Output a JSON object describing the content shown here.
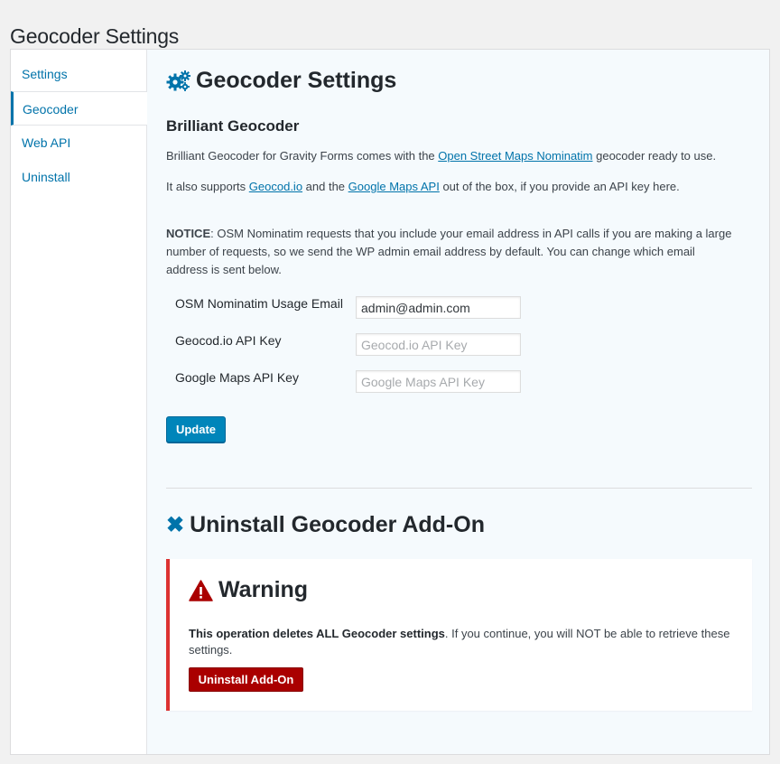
{
  "page_title": "Geocoder Settings",
  "sidebar": {
    "items": [
      {
        "label": "Settings",
        "active": false
      },
      {
        "label": "Geocoder",
        "active": true
      },
      {
        "label": "Web API",
        "active": false
      },
      {
        "label": "Uninstall",
        "active": false
      }
    ]
  },
  "main": {
    "heading": "Geocoder Settings",
    "heading_icon": "gears-icon",
    "subheading": "Brilliant Geocoder",
    "intro": {
      "before": "Brilliant Geocoder for Gravity Forms comes with the ",
      "link": "Open Street Maps Nominatim",
      "after": " geocoder ready to use."
    },
    "supports": {
      "before": "It also supports ",
      "link1": "Geocod.io",
      "middle": " and the ",
      "link2": "Google Maps API",
      "after": " out of the box, if you provide an API key here."
    },
    "notice": {
      "label": "NOTICE",
      "text": ": OSM Nominatim requests that you include your email address in API calls if you are making a large number of requests, so we send the WP admin email address by default. You can change which email address is sent below."
    },
    "fields": {
      "osm_email": {
        "label": "OSM Nominatim Usage Email",
        "value": "admin@admin.com",
        "placeholder": ""
      },
      "geocodio_key": {
        "label": "Geocod.io API Key",
        "value": "",
        "placeholder": "Geocod.io API Key"
      },
      "google_key": {
        "label": "Google Maps API Key",
        "value": "",
        "placeholder": "Google Maps API Key"
      }
    },
    "update_label": "Update"
  },
  "uninstall": {
    "heading": "Uninstall Geocoder Add-On",
    "heading_icon": "close-x-icon",
    "warning_title": "Warning",
    "warning_icon": "warning-triangle-icon",
    "warning_bold": "This operation deletes ALL Geocoder settings",
    "warning_rest": ". If you continue, you will NOT be able to retrieve these settings.",
    "button_label": "Uninstall Add-On"
  },
  "colors": {
    "link": "#0073aa",
    "primary_button": "#0085ba",
    "danger": "#aa0000",
    "warning_border": "#dc3232"
  }
}
